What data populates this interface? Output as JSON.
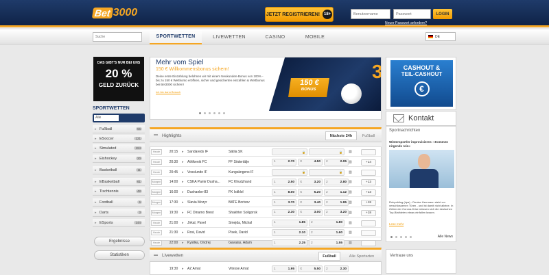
{
  "header": {
    "logo_prefix": "Bet",
    "logo_suffix": "3000",
    "register_label": "JETZT REGISTRIEREN!",
    "age_badge": "18+",
    "username_placeholder": "Benutzername",
    "password_placeholder": "Passwort",
    "login_label": "LOGIN",
    "forgot_label": "Neuer Passwort anfordern?"
  },
  "nav": {
    "search_placeholder": "Suche",
    "tabs": [
      "SPORTWETTEN",
      "LIVEWETTEN",
      "CASINO",
      "MOBILE"
    ],
    "language": "DE"
  },
  "promo": {
    "top": "DAS GIBT'S NUR BEI UNS",
    "big": "20 %",
    "bottom": "GELD ZURÜCK"
  },
  "sidebar": {
    "heading": "SPORTWETTEN",
    "filter_value": "Alle",
    "items": [
      {
        "label": "Fußball",
        "count": "56"
      },
      {
        "label": "ESoccer",
        "count": "121"
      },
      {
        "label": "Simulated",
        "count": "194"
      },
      {
        "label": "Eishockey",
        "count": "20"
      },
      {
        "label": "Basketball",
        "count": "11"
      },
      {
        "label": "EBasketball",
        "count": "61"
      },
      {
        "label": "Tischtennis",
        "count": "48"
      },
      {
        "label": "Football",
        "count": "6"
      },
      {
        "label": "Darts",
        "count": "3"
      },
      {
        "label": "ESports",
        "count": "144"
      }
    ],
    "results_label": "Ergebnisse",
    "stats_label": "Statistiken"
  },
  "banner": {
    "heading": "Mehr vom Spiel",
    "subheading": "150 € Willkommensbonus sichern!",
    "text": "Deine erste Einzahlung belohnen wir mit einem Neukunden-Bonus von 100% - bis zu 150 € Wettkonto eröffnen, sicher und gesicherten einzahlen & Wettbonus bei Bet3000 sichern!",
    "link": "Ich bin dann Besuch",
    "bonus_amount": "150 €",
    "bonus_word": "BONUS"
  },
  "highlights": {
    "title": "Highlights",
    "tab_next": "Nächste 24h",
    "tab_football": "Fußball",
    "rows": [
      {
        "day": "Heute",
        "time": "20:15",
        "home": "Sandareds IF",
        "away": "Sätila SK",
        "o1": "",
        "ox": "",
        "o2": "",
        "more": ""
      },
      {
        "day": "Heute",
        "time": "20:30",
        "home": "Athlkenik FC",
        "away": "FF Södertälje",
        "o1": "2.70",
        "ox": "4.50",
        "o2": "2.05",
        "more": "+14"
      },
      {
        "day": "Heute",
        "time": "20:45",
        "home": "Vosslundo IF",
        "away": "Kungsängens IF",
        "o1": "",
        "ox": "",
        "o2": "",
        "more": ""
      },
      {
        "day": "Morgen",
        "time": "14:00",
        "home": "CSKA Pamir Dusha...",
        "away": "FC Khudzhand",
        "o1": "2.50",
        "ox": "3.20",
        "o2": "2.80",
        "more": "+13"
      },
      {
        "day": "Morgen",
        "time": "16:00",
        "home": "Dushanbe-83",
        "away": "FK Istiklol",
        "o1": "8.00",
        "ox": "5.20",
        "o2": "1.12",
        "more": "+13"
      },
      {
        "day": "Morgen",
        "time": "17:30",
        "home": "Slavia Mozyr",
        "away": "BATE Borisov",
        "o1": "3.70",
        "ox": "3.40",
        "o2": "1.95",
        "more": "+18"
      },
      {
        "day": "Morgen",
        "time": "19:30",
        "home": "FC Dinamo Brest",
        "away": "Shakhter Soligorsk",
        "o1": "2.30",
        "ox": "3.00",
        "o2": "3.20",
        "more": "+18"
      },
      {
        "day": "Heute",
        "time": "21:00",
        "home": "Jirkal, Pavel",
        "away": "Smejda, Michal",
        "o1": "1.85",
        "ox": "",
        "o2": "1.80",
        "more": ""
      },
      {
        "day": "Heute",
        "time": "21:30",
        "home": "Rosi, David",
        "away": "Pisek, David",
        "o1": "2.10",
        "ox": "",
        "o2": "1.60",
        "more": ""
      },
      {
        "day": "Heute",
        "time": "22:00",
        "home": "Kysilka, Ondrej",
        "away": "Gavalas, Adam",
        "o1": "2.25",
        "ox": "",
        "o2": "1.55",
        "more": ""
      }
    ]
  },
  "live": {
    "title": "Livewetten",
    "tab_football": "Fußball",
    "tab_all": "Alle Sportarten",
    "row": {
      "time": "19:30",
      "home": "AZ Amat",
      "away": "Vitesse Arnat",
      "o1": "1.95",
      "ox": "5.50",
      "o2": "2.30"
    }
  },
  "right": {
    "cashout_l1": "CASHOUT &",
    "cashout_l2": "TEIL-CASHOUT",
    "contact": "Kontakt",
    "news_title": "Sportnachrichten",
    "news_headline": "Wintersportler improvisieren: «Kommen nirgends rein»",
    "news_text": "Ruhpolding (dpa) - Denise Herrmann steht vor verschlossenen Türen - und ist damit nicht alleine. In Zeiten der Corona-Krise müssen sich die deutschen Top-Biathleten etwas einfallen lassen.",
    "news_more": "Lese mehr",
    "news_all": "Alle News",
    "trust_title": "Vertraue uns"
  }
}
